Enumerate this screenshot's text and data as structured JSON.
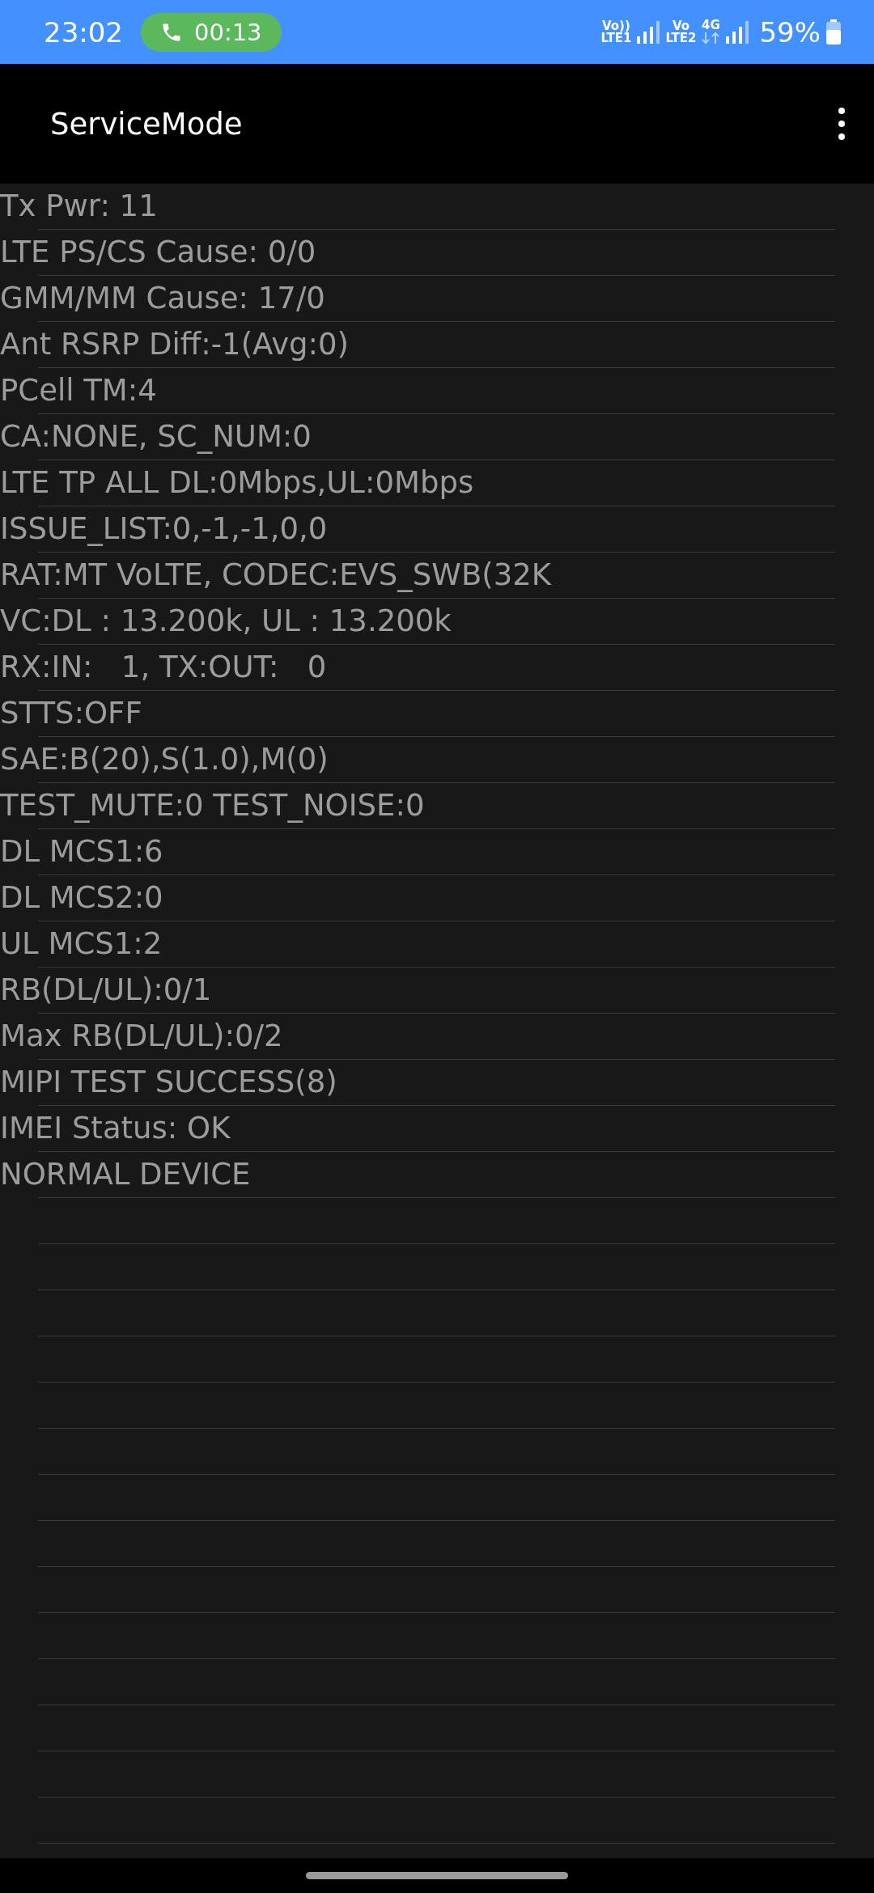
{
  "status_bar": {
    "time": "23:02",
    "call_timer": "00:13",
    "sim1_top": "Vo))",
    "sim1_bottom": "LTE1",
    "sim2_top": "Vo",
    "sim2_bottom": "LTE2",
    "network_type": "4G",
    "battery": "59%"
  },
  "app_bar": {
    "title": "ServiceMode"
  },
  "lines": [
    "Tx Pwr: 11",
    "LTE PS/CS Cause: 0/0",
    "GMM/MM Cause: 17/0",
    "Ant RSRP Diff:-1(Avg:0)",
    "PCell TM:4",
    "CA:NONE, SC_NUM:0",
    "LTE TP ALL DL:0Mbps,UL:0Mbps",
    "ISSUE_LIST:0,-1,-1,0,0",
    "RAT:MT VoLTE, CODEC:EVS_SWB(32K",
    "VC:DL : 13.200k, UL : 13.200k",
    "RX:IN:   1, TX:OUT:   0",
    "STTS:OFF",
    "SAE:B(20),S(1.0),M(0)",
    "TEST_MUTE:0 TEST_NOISE:0",
    "DL MCS1:6",
    "DL MCS2:0",
    "UL MCS1:2",
    "RB(DL/UL):0/1",
    "Max RB(DL/UL):0/2",
    "MIPI TEST SUCCESS(8)",
    "IMEI Status: OK",
    "NORMAL DEVICE"
  ]
}
